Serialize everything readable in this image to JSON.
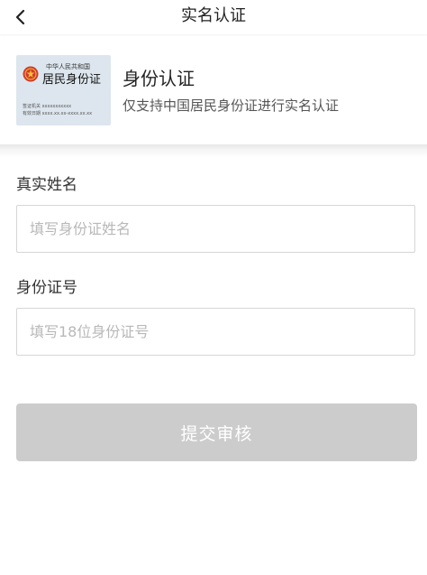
{
  "header": {
    "back_icon": "chevron-left-icon",
    "title": "实名认证"
  },
  "info_card": {
    "card_image": {
      "top_line": "中华人民共和国",
      "main_line": "居民身份证",
      "issuer_line": "签证机关  xxxxxxxxxxx",
      "validity_line": "有效日期  xxxx.xx.xx-xxxx.xx.xx"
    },
    "heading": "身份认证",
    "subtitle": "仅支持中国居民身份证进行实名认证"
  },
  "form": {
    "name_label": "真实姓名",
    "name_placeholder": "填写身份证姓名",
    "name_value": "",
    "id_label": "身份证号",
    "id_placeholder": "填写18位身份证号",
    "id_value": "",
    "submit_label": "提交审核",
    "submit_color": "#cccccc"
  }
}
